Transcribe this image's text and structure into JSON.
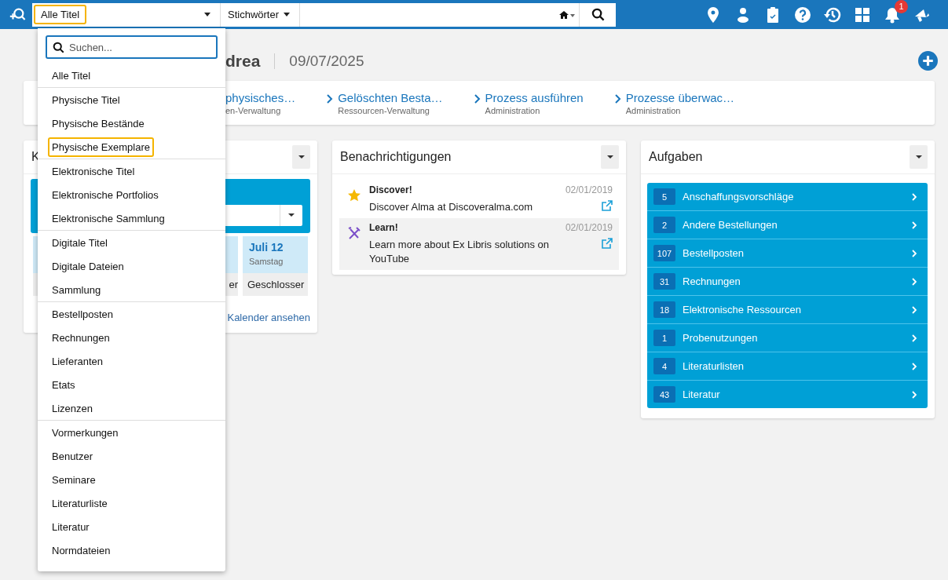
{
  "top_bar": {
    "scope_select": {
      "value": "Alle Titel",
      "focused": true
    },
    "field_select": {
      "value": "Stichwörter"
    },
    "notification_badge": "1"
  },
  "scope_menu": {
    "search": {
      "placeholder": "Suchen..."
    },
    "groups": [
      [
        {
          "label": "Alle Titel",
          "focused": false
        }
      ],
      [
        {
          "label": "Physische Titel",
          "focused": false
        },
        {
          "label": "Physische Bestände",
          "focused": false
        },
        {
          "label": "Physische Exemplare",
          "focused": true
        }
      ],
      [
        {
          "label": "Elektronische Titel",
          "focused": false
        },
        {
          "label": "Elektronische Portfolios",
          "focused": false
        },
        {
          "label": "Elektronische Sammlung",
          "focused": false
        }
      ],
      [
        {
          "label": "Digitale Titel",
          "focused": false
        },
        {
          "label": "Digitale Dateien",
          "focused": false
        },
        {
          "label": "Sammlung",
          "focused": false
        }
      ],
      [
        {
          "label": "Bestellposten",
          "focused": false
        },
        {
          "label": "Rechnungen",
          "focused": false
        },
        {
          "label": "Lieferanten",
          "focused": false
        },
        {
          "label": "Etats",
          "focused": false
        },
        {
          "label": "Lizenzen",
          "focused": false
        }
      ],
      [
        {
          "label": "Vormerkungen",
          "focused": false
        },
        {
          "label": "Benutzer",
          "focused": false
        },
        {
          "label": "Seminare",
          "focused": false
        },
        {
          "label": "Literaturliste",
          "focused": false
        },
        {
          "label": "Literatur",
          "focused": false
        },
        {
          "label": "Normdateien",
          "focused": false
        }
      ]
    ]
  },
  "welcome": {
    "title_end": "drea",
    "date": "09/07/2025"
  },
  "quick_links": [
    {
      "title": "physisches…",
      "subtitle": "en-Verwaltung"
    },
    {
      "title": "Gelöschten Besta…",
      "subtitle": "Ressourcen-Verwaltung"
    },
    {
      "title": "Prozess ausführen",
      "subtitle": "Administration"
    },
    {
      "title": "Prozesse überwac…",
      "subtitle": "Administration"
    }
  ],
  "calendar_widget": {
    "title": "K",
    "days": [
      {
        "status": "er"
      },
      {
        "date": "Juli 12",
        "weekday": "Samstag",
        "status": "Geschlosser"
      }
    ],
    "link": "Kalender ansehen"
  },
  "notifications_widget": {
    "title": "Benachrichtigungen",
    "items": [
      {
        "kind": "star",
        "title": "Discover!",
        "text": "Discover Alma at Discoveralma.com",
        "date": "02/01/2019"
      },
      {
        "kind": "tools",
        "title": "Learn!",
        "text": "Learn more about Ex Libris solutions on YouTube",
        "date": "02/01/2019"
      }
    ]
  },
  "tasks_widget": {
    "title": "Aufgaben",
    "items": [
      {
        "count": "5",
        "label": "Anschaffungsvorschläge"
      },
      {
        "count": "2",
        "label": "Andere Bestellungen"
      },
      {
        "count": "107",
        "label": "Bestellposten"
      },
      {
        "count": "31",
        "label": "Rechnungen"
      },
      {
        "count": "18",
        "label": "Elektronische Ressourcen"
      },
      {
        "count": "1",
        "label": "Probenutzungen"
      },
      {
        "count": "4",
        "label": "Literaturlisten"
      },
      {
        "count": "43",
        "label": "Literatur"
      }
    ]
  }
}
